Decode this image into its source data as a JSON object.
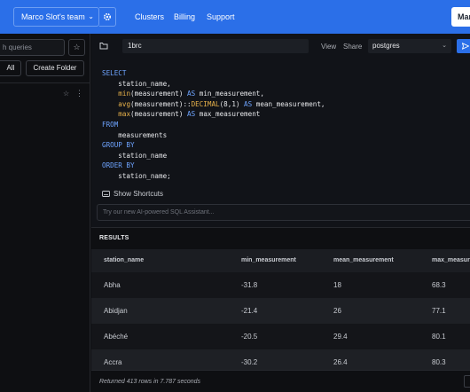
{
  "topbar": {
    "team": "Marco Slot's team",
    "nav": [
      "Clusters",
      "Billing",
      "Support"
    ],
    "right_button": "Mar",
    "accent": "#2b6fe8"
  },
  "left": {
    "search_placeholder": "h queries",
    "all_label": "All",
    "create_folder_label": "Create Folder"
  },
  "editor": {
    "query_name": "1brc",
    "view_label": "View",
    "share_label": "Share",
    "database": "postgres",
    "code": [
      "SELECT",
      "    station_name,",
      "    min(measurement) AS min_measurement,",
      "    avg(measurement)::DECIMAL(8,1) AS mean_measurement,",
      "    max(measurement) AS max_measurement",
      "FROM",
      "    measurements",
      "GROUP BY",
      "    station_name",
      "ORDER BY",
      "    station_name;"
    ],
    "shortcuts_label": "Show Shortcuts",
    "ai_placeholder": "Try our new AI-powered SQL Assistant..."
  },
  "results": {
    "title": "RESULTS",
    "columns": [
      "station_name",
      "min_measurement",
      "mean_measurement",
      "max_measurement"
    ],
    "rows": [
      [
        "Abha",
        "-31.8",
        "18",
        "68.3"
      ],
      [
        "Abidjan",
        "-21.4",
        "26",
        "77.1"
      ],
      [
        "Abéché",
        "-20.5",
        "29.4",
        "80.1"
      ],
      [
        "Accra",
        "-30.2",
        "26.4",
        "80.3"
      ]
    ],
    "footer": "Returned 413 rows in 7.787 seconds"
  }
}
